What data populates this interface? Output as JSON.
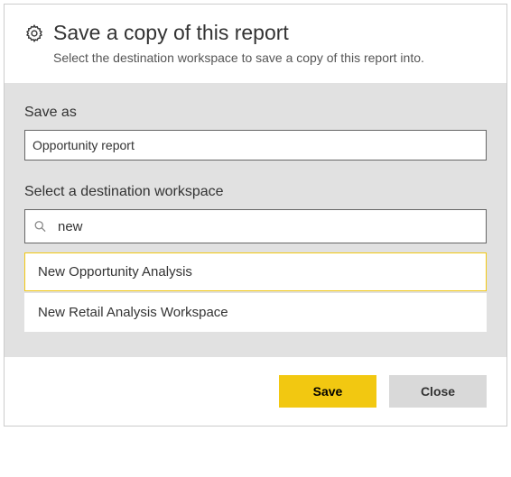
{
  "header": {
    "title": "Save a copy of this report",
    "subtitle": "Select the destination workspace to save a copy of this report into."
  },
  "save_as": {
    "label": "Save as",
    "value": "Opportunity report"
  },
  "workspace": {
    "label": "Select a destination workspace",
    "search_value": "new",
    "items": [
      {
        "label": "New Opportunity Analysis",
        "selected": true
      },
      {
        "label": "New Retail Analysis Workspace",
        "selected": false
      }
    ]
  },
  "footer": {
    "save_label": "Save",
    "close_label": "Close"
  }
}
